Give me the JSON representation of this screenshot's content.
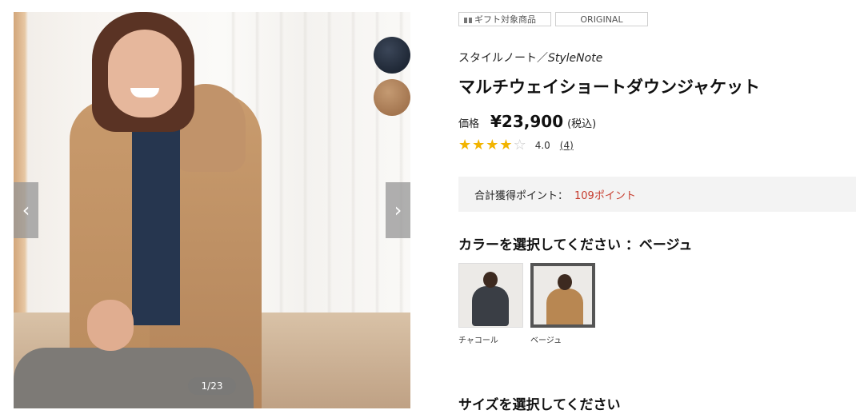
{
  "gallery": {
    "counter": "1/23",
    "prev_arrow": "‹",
    "next_arrow": "›",
    "swatches": [
      {
        "icon": "charcoal-swatch-icon",
        "color": "#2a3342"
      },
      {
        "icon": "beige-swatch-icon",
        "color": "#b58a62"
      }
    ]
  },
  "tags": {
    "gift": "ギフト対象商品",
    "original": "ORIGINAL"
  },
  "brand": {
    "jp": "スタイルノート／",
    "en": "StyleNote"
  },
  "product": {
    "title": "マルチウェイショートダウンジャケット",
    "price_label": "価格",
    "price": "¥23,900",
    "tax": "(税込)"
  },
  "rating": {
    "value": 4.0,
    "value_text": "4.0",
    "count_text": "(4)",
    "max": 5,
    "star_color": "#f2b400"
  },
  "points": {
    "label": "合計獲得ポイント：",
    "value": "109ポイント",
    "value_color": "#c63b2c"
  },
  "color_select": {
    "heading": "カラーを選択してください ：ベージュ",
    "options": [
      {
        "name": "チャコール",
        "selected": false
      },
      {
        "name": "ベージュ",
        "selected": true
      }
    ]
  },
  "size_select": {
    "heading": "サイズを選択してください"
  }
}
